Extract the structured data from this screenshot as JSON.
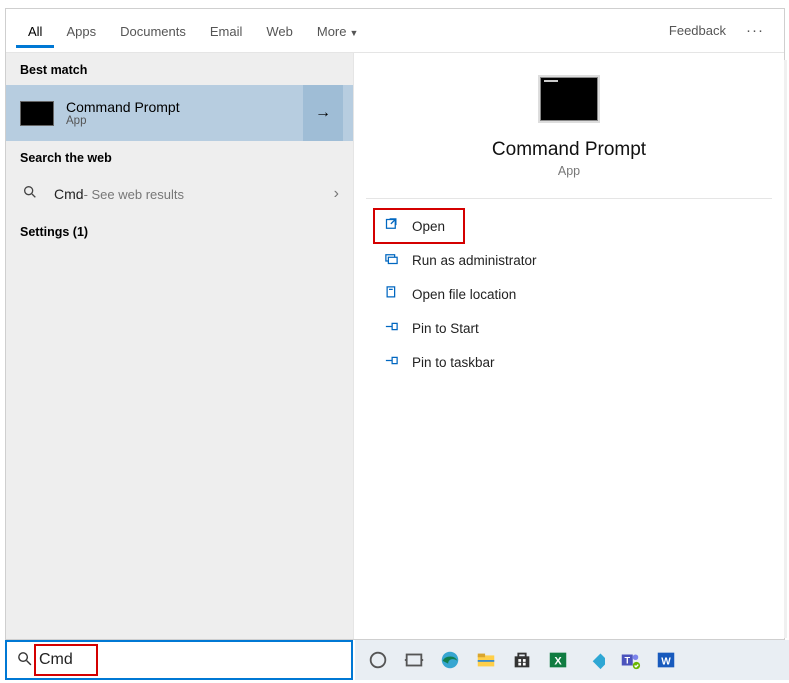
{
  "tabs": {
    "all": "All",
    "apps": "Apps",
    "documents": "Documents",
    "email": "Email",
    "web": "Web",
    "more": "More"
  },
  "header": {
    "feedback": "Feedback"
  },
  "left": {
    "best_match_label": "Best match",
    "best_match": {
      "title": "Command Prompt",
      "subtitle": "App"
    },
    "search_web_label": "Search the web",
    "web_query": "Cmd",
    "web_hint": " - See web results",
    "settings_label": "Settings (1)"
  },
  "preview": {
    "title": "Command Prompt",
    "subtitle": "App"
  },
  "actions": {
    "open": "Open",
    "run_admin": "Run as administrator",
    "open_location": "Open file location",
    "pin_start": "Pin to Start",
    "pin_taskbar": "Pin to taskbar"
  },
  "search": {
    "value": "Cmd"
  },
  "taskbar_icons": [
    "cortana",
    "task-view",
    "edge",
    "explorer",
    "store",
    "excel",
    "kodi",
    "teams",
    "word"
  ]
}
